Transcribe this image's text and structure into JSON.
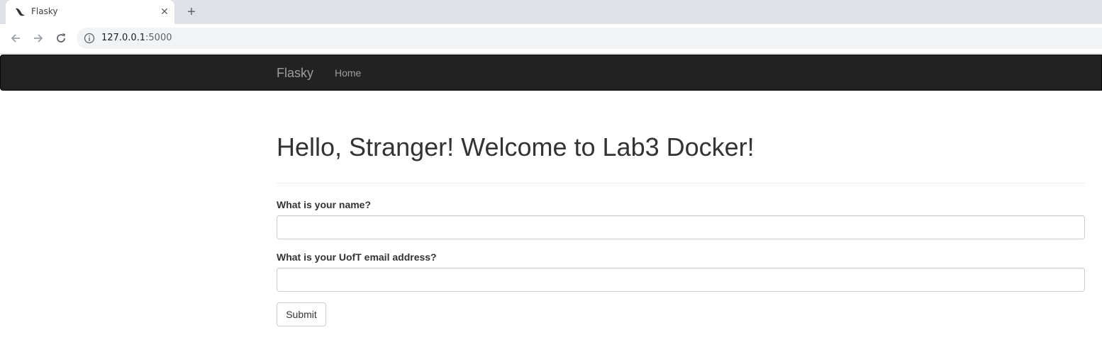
{
  "browser": {
    "tab_title": "Flasky",
    "url_host": "127.0.0.1",
    "url_port": ":5000"
  },
  "navbar": {
    "brand": "Flasky",
    "home_link": "Home",
    "background": "#222222"
  },
  "page": {
    "title": "Hello, Stranger! Welcome to Lab3 Docker!"
  },
  "form": {
    "name_label": "What is your name?",
    "name_value": "",
    "email_label": "What is your UofT email address?",
    "email_value": "",
    "submit_label": "Submit"
  },
  "icons": {
    "favicon": "flask-horn-icon",
    "back": "arrow-left-icon",
    "forward": "arrow-right-icon",
    "reload": "reload-icon",
    "info": "info-icon",
    "close": "close-icon",
    "new_tab": "plus-icon"
  }
}
